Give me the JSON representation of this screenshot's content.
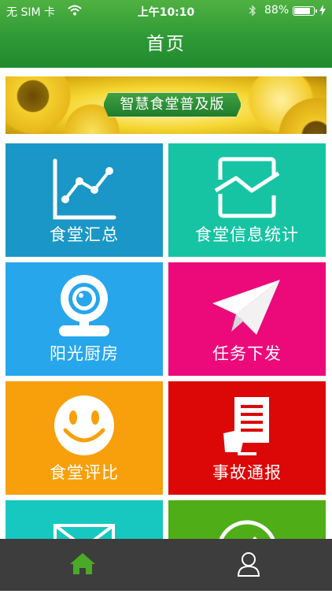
{
  "status_bar": {
    "carrier": "无 SIM 卡",
    "time": "上午10:10",
    "battery": "88%",
    "battery_level": 0.88
  },
  "header": {
    "title": "首页"
  },
  "banner": {
    "text": "智慧食堂普及版"
  },
  "tiles": [
    {
      "label": "食堂汇总",
      "icon": "line-chart-icon",
      "color": "#1a97c6"
    },
    {
      "label": "食堂信息统计",
      "icon": "trend-chart-icon",
      "color": "#16c4a3"
    },
    {
      "label": "阳光厨房",
      "icon": "webcam-icon",
      "color": "#27a6ec"
    },
    {
      "label": "任务下发",
      "icon": "paper-plane-icon",
      "color": "#ec0a7b"
    },
    {
      "label": "食堂评比",
      "icon": "smiley-face-icon",
      "color": "#f7a00b"
    },
    {
      "label": "事故通报",
      "icon": "report-document-icon",
      "color": "#dc0707"
    },
    {
      "label": "",
      "icon": "envelope-icon",
      "color": "#17c8c0"
    },
    {
      "label": "",
      "icon": "edit-pencil-icon",
      "color": "#4fae17"
    }
  ],
  "tabbar": {
    "items": [
      {
        "name": "home",
        "icon": "home-icon",
        "active": true,
        "color": "#4aaa26"
      },
      {
        "name": "profile",
        "icon": "user-icon",
        "active": false,
        "color": "#ffffff"
      }
    ]
  }
}
